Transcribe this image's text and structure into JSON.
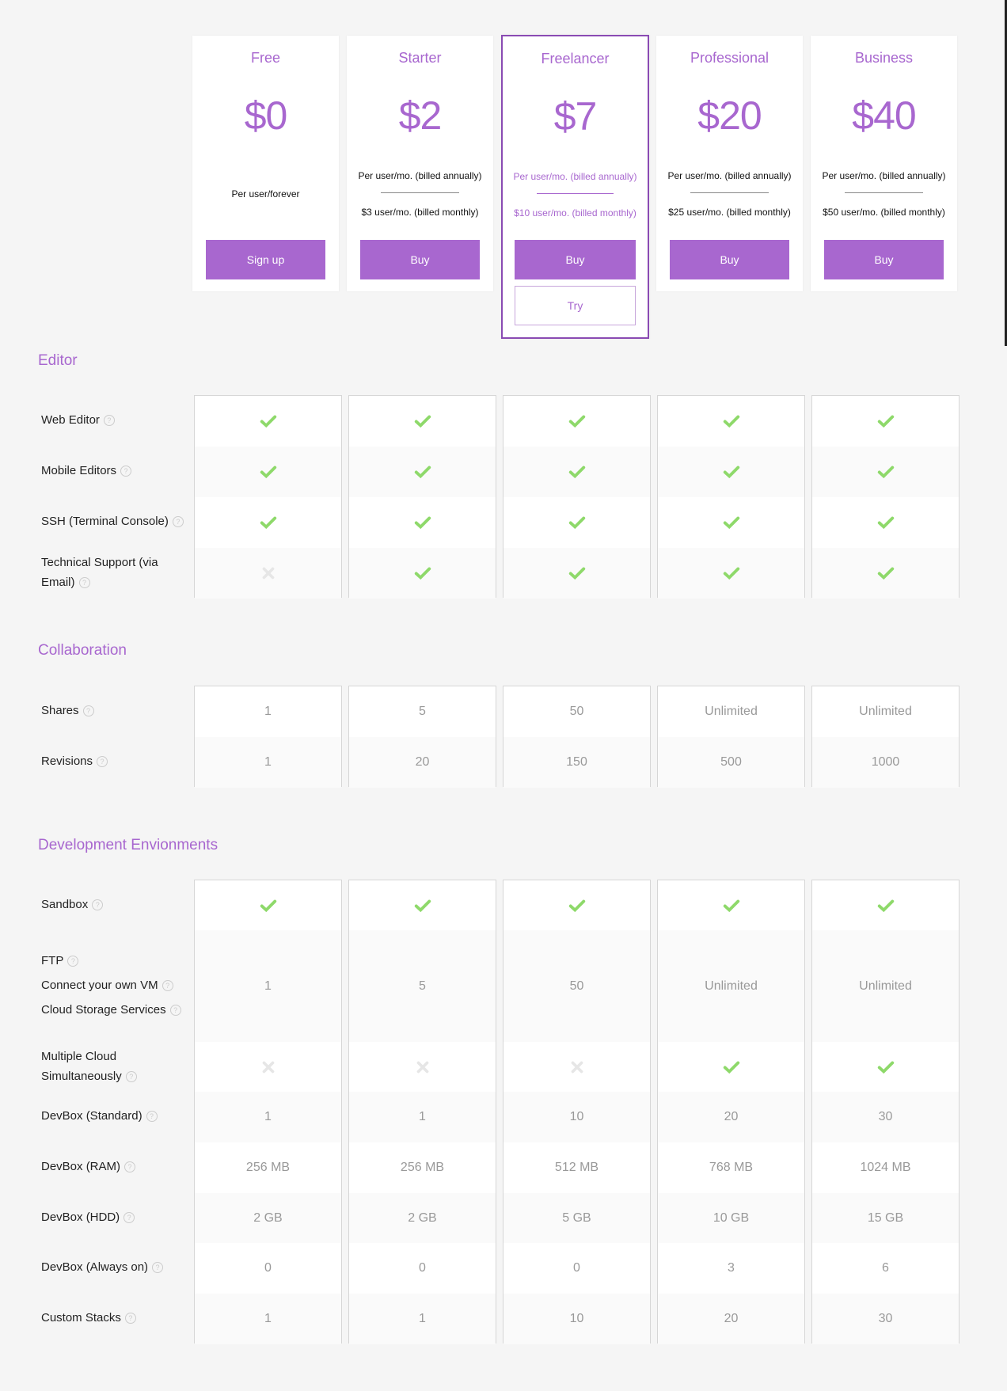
{
  "colors": {
    "accent": "#a867cf",
    "highlight_border": "#8a4bb3",
    "check": "#8ed96a",
    "cross": "#e6e6e6"
  },
  "plans": [
    {
      "name": "Free",
      "price": "$0",
      "billing_single": "Per user/forever",
      "button": "Sign up"
    },
    {
      "name": "Starter",
      "price": "$2",
      "billing_annual": "Per user/mo. (billed annually)",
      "billing_monthly": "$3 user/mo. (billed monthly)",
      "button": "Buy"
    },
    {
      "name": "Freelancer",
      "price": "$7",
      "billing_annual": "Per user/mo. (billed annually)",
      "billing_monthly": "$10 user/mo. (billed monthly)",
      "button": "Buy",
      "try_button": "Try",
      "highlighted": true
    },
    {
      "name": "Professional",
      "price": "$20",
      "billing_annual": "Per user/mo. (billed annually)",
      "billing_monthly": "$25 user/mo. (billed monthly)",
      "button": "Buy"
    },
    {
      "name": "Business",
      "price": "$40",
      "billing_annual": "Per user/mo. (billed annually)",
      "billing_monthly": "$50 user/mo. (billed monthly)",
      "button": "Buy"
    }
  ],
  "sections": [
    {
      "title": "Editor",
      "rows": [
        {
          "labels": [
            "Web Editor"
          ],
          "values": [
            "check",
            "check",
            "check",
            "check",
            "check"
          ]
        },
        {
          "labels": [
            "Mobile Editors"
          ],
          "values": [
            "check",
            "check",
            "check",
            "check",
            "check"
          ]
        },
        {
          "labels": [
            "SSH (Terminal Console)"
          ],
          "values": [
            "check",
            "check",
            "check",
            "check",
            "check"
          ]
        },
        {
          "labels": [
            "Technical Support (via Email)"
          ],
          "values": [
            "cross",
            "check",
            "check",
            "check",
            "check"
          ]
        }
      ]
    },
    {
      "title": "Collaboration",
      "rows": [
        {
          "labels": [
            "Shares"
          ],
          "values": [
            "1",
            "5",
            "50",
            "Unlimited",
            "Unlimited"
          ]
        },
        {
          "labels": [
            "Revisions"
          ],
          "values": [
            "1",
            "20",
            "150",
            "500",
            "1000"
          ]
        }
      ]
    },
    {
      "title": "Development Envionments",
      "rows": [
        {
          "labels": [
            "Sandbox"
          ],
          "values": [
            "check",
            "check",
            "check",
            "check",
            "check"
          ]
        },
        {
          "labels": [
            "FTP",
            "Connect your own VM",
            "Cloud Storage Services"
          ],
          "values": [
            "1",
            "5",
            "50",
            "Unlimited",
            "Unlimited"
          ]
        },
        {
          "labels": [
            "Multiple Cloud Simultaneously"
          ],
          "values": [
            "cross",
            "cross",
            "cross",
            "check",
            "check"
          ]
        },
        {
          "labels": [
            "DevBox (Standard)"
          ],
          "values": [
            "1",
            "1",
            "10",
            "20",
            "30"
          ]
        },
        {
          "labels": [
            "DevBox (RAM)"
          ],
          "values": [
            "256 MB",
            "256 MB",
            "512 MB",
            "768 MB",
            "1024 MB"
          ]
        },
        {
          "labels": [
            "DevBox (HDD)"
          ],
          "values": [
            "2 GB",
            "2 GB",
            "5 GB",
            "10 GB",
            "15 GB"
          ]
        },
        {
          "labels": [
            "DevBox (Always on)"
          ],
          "values": [
            "0",
            "0",
            "0",
            "3",
            "6"
          ]
        },
        {
          "labels": [
            "Custom Stacks"
          ],
          "values": [
            "1",
            "1",
            "10",
            "20",
            "30"
          ]
        }
      ]
    }
  ],
  "help_glyph": "?"
}
